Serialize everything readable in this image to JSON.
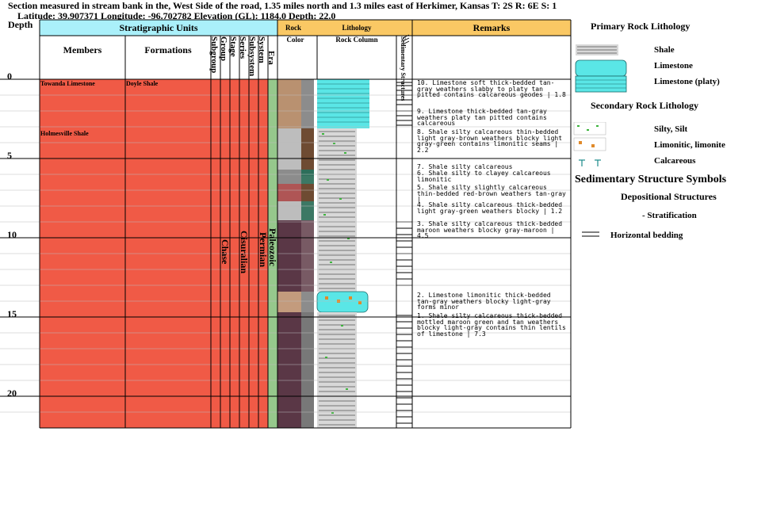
{
  "header": {
    "line1": "Section measured in stream bank in the, West Side of the road, 1.35 miles north and 1.3 miles east of Herkimer, Kansas T: 2S R: 6E S: 1",
    "line2": "Latitude: 39.907371 Longitude: -96.702782 Elevation (GL): 1184.0 Depth: 22.0"
  },
  "columns": {
    "depth": "Depth",
    "stratigraphic_units": "Stratigraphic Units",
    "members": "Members",
    "formations": "Formations",
    "subgroup": "Subgroup",
    "group": "Group",
    "stage": "Stage",
    "series": "Series",
    "subsystem": "Subsystem",
    "system": "System",
    "era": "Era",
    "rock": "Rock",
    "color": "Color",
    "lithology": "Lithology",
    "rock_column": "Rock Column",
    "sedimentary_structures": "Sedimentary Structures",
    "remarks": "Remarks"
  },
  "depth_ticks": [
    "0",
    "5",
    "10",
    "15",
    "20"
  ],
  "members": [
    "Towanda Limestone",
    "Holmesville Shale"
  ],
  "formations": [
    "Doyle Shale"
  ],
  "units": {
    "group": "Chase",
    "series": "Cisuralian",
    "system": "Permian",
    "era": "Paleozoic"
  },
  "remarks": [
    "10. Limestone soft thick-bedded tan-gray weathers slabby to platy tan pitted contains calcareous geodes | 1.8",
    "9. Limestone thick-bedded tan-gray weathers platy tan pitted contains calcareous",
    "8. Shale silty calcareous thin-bedded light gray-brown weathers blocky light gray-green contains limonitic seams | 2.2",
    "7. Shale silty calcareous",
    "6. Shale silty to clayey calcareous limonitic",
    "5. Shale silty slightly calcareous thin-bedded red-brown weathers tan-gray |",
    "4. Shale silty calcareous thick-bedded light gray-green weathers blocky | 1.2",
    "3. Shale silty calcareous thick-bedded maroon weathers blocky gray-maroon | 4.5",
    "2. Limestone limonitic thick-bedded tan-gray weathers blocky light-gray forms minor",
    "1. Shale silty calcareous thick-bedded mottled maroon green and tan weathers blocky light-gray contains thin lentils of limestone | 7.3"
  ],
  "legend": {
    "primary_title": "Primary Rock Lithology",
    "primary": [
      "Shale",
      "Limestone",
      "Limestone (platy)"
    ],
    "secondary_title": "Secondary Rock Lithology",
    "secondary": [
      "Silty, Silt",
      "Limonitic, limonite",
      "Calcareous"
    ],
    "sed_title": "Sedimentary Structure Symbols",
    "depositional": "Depositional Structures",
    "stratification": "- Stratification",
    "horizontal": "Horizontal bedding"
  },
  "colors": {
    "units_fill": "#f05a46",
    "header_cyan": "#aaf0fa",
    "header_orange": "#fac864",
    "era_green": "#96c88c",
    "limestone": "#5ae6e6"
  }
}
